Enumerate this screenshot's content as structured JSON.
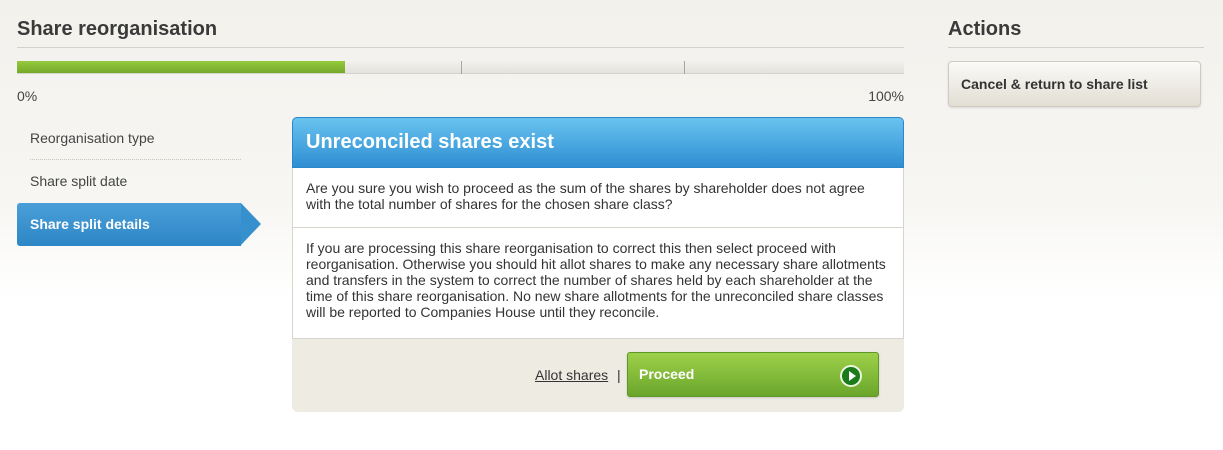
{
  "header": {
    "title": "Share reorganisation"
  },
  "progress": {
    "value_percent": 37,
    "min_label": "0%",
    "max_label": "100%",
    "fill_color": "#7fb530"
  },
  "steps": [
    {
      "label": "Reorganisation type",
      "active": false
    },
    {
      "label": "Share split date",
      "active": false
    },
    {
      "label": "Share split details",
      "active": true
    }
  ],
  "dialog": {
    "title": "Unreconciled shares exist",
    "paragraph1": "Are you sure you wish to proceed as the sum of the shares by shareholder does not agree with the total number of shares for the chosen share class?",
    "paragraph2": "If you are processing this share reorganisation to correct this then select proceed with reorganisation. Otherwise you should hit allot shares to make any necessary share allotments and transfers in the system to correct the number of shares held by each shareholder at the time of this share reorganisation. No new share allotments for the unreconciled share classes will be reported to Companies House until they reconcile.",
    "allot_link": "Allot shares",
    "separator": "|",
    "proceed_label": "Proceed",
    "header_color": "#3fa0de"
  },
  "actions": {
    "title": "Actions",
    "cancel_label": "Cancel & return to share list"
  },
  "icons": {
    "proceed": "play-circle-icon"
  }
}
